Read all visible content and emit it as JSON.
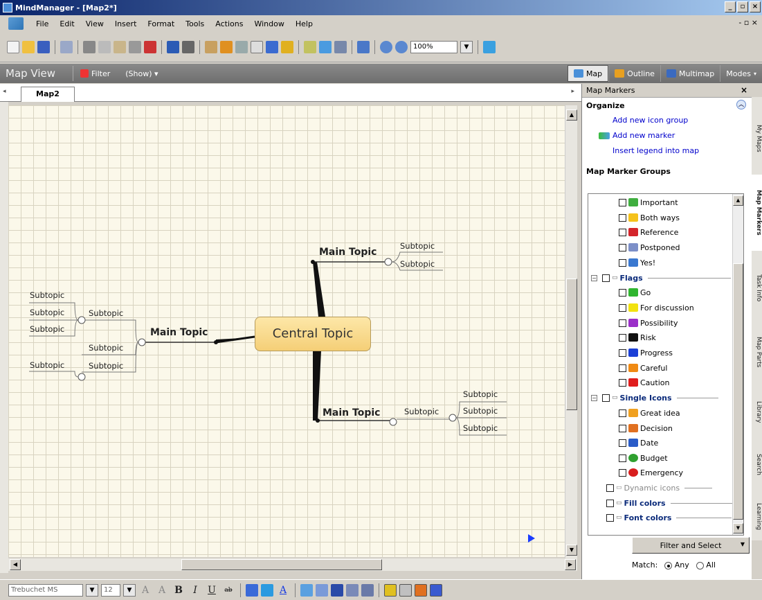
{
  "window": {
    "title": "MindManager - [Map2*]",
    "controls": [
      "_",
      "▫",
      "×"
    ]
  },
  "menu": {
    "items": [
      "File",
      "Edit",
      "View",
      "Insert",
      "Format",
      "Tools",
      "Actions",
      "Window",
      "Help"
    ],
    "right": "- ▫ ×"
  },
  "toolbar": {
    "zoom": "100%"
  },
  "viewbar": {
    "title": "Map View",
    "filter": "Filter",
    "show": "(Show)  ▾",
    "modes": [
      "Map",
      "Outline",
      "Multimap",
      "Modes"
    ]
  },
  "tabs": {
    "active": "Map2"
  },
  "map": {
    "central": "Central Topic",
    "main_topics": [
      "Main Topic",
      "Main Topic",
      "Main Topic"
    ],
    "subtopic": "Subtopic"
  },
  "panel": {
    "title": "Map Markers",
    "organize": "Organize",
    "links": [
      "Add new icon group",
      "Add new marker",
      "Insert legend into map"
    ],
    "groups_title": "Map Marker Groups",
    "markers_top": [
      {
        "label": "Important",
        "color": "#3fae3f"
      },
      {
        "label": "Both ways",
        "color": "#f5c21b"
      },
      {
        "label": "Reference",
        "color": "#d4252b"
      },
      {
        "label": "Postponed",
        "color": "#7c8fc8"
      },
      {
        "label": "Yes!",
        "color": "#3a78d0"
      }
    ],
    "flags_group": "Flags",
    "flags": [
      {
        "label": "Go",
        "color": "#2fb52f"
      },
      {
        "label": "For discussion",
        "color": "#f2e20f"
      },
      {
        "label": "Possibility",
        "color": "#9b2fc9"
      },
      {
        "label": "Risk",
        "color": "#111111"
      },
      {
        "label": "Progress",
        "color": "#1b3fd6"
      },
      {
        "label": "Careful",
        "color": "#f08a13"
      },
      {
        "label": "Caution",
        "color": "#e01d1d"
      }
    ],
    "single_group": "Single Icons",
    "singles": [
      {
        "label": "Great idea",
        "color": "#f0a020"
      },
      {
        "label": "Decision",
        "color": "#e07020"
      },
      {
        "label": "Date",
        "color": "#2a5cc8"
      },
      {
        "label": "Budget",
        "color": "#2fa02f"
      },
      {
        "label": "Emergency",
        "color": "#d81e1e"
      }
    ],
    "other_groups": [
      "Dynamic icons",
      "Fill colors",
      "Font colors"
    ],
    "filter_button": "Filter and Select",
    "match_label": "Match:",
    "match_any": "Any",
    "match_all": "All"
  },
  "side_tabs": [
    "My Maps",
    "Map Markers",
    "Task Info",
    "Map Parts",
    "Library",
    "Search",
    "Learning"
  ],
  "format": {
    "font": "Trebuchet MS",
    "size": "12"
  }
}
